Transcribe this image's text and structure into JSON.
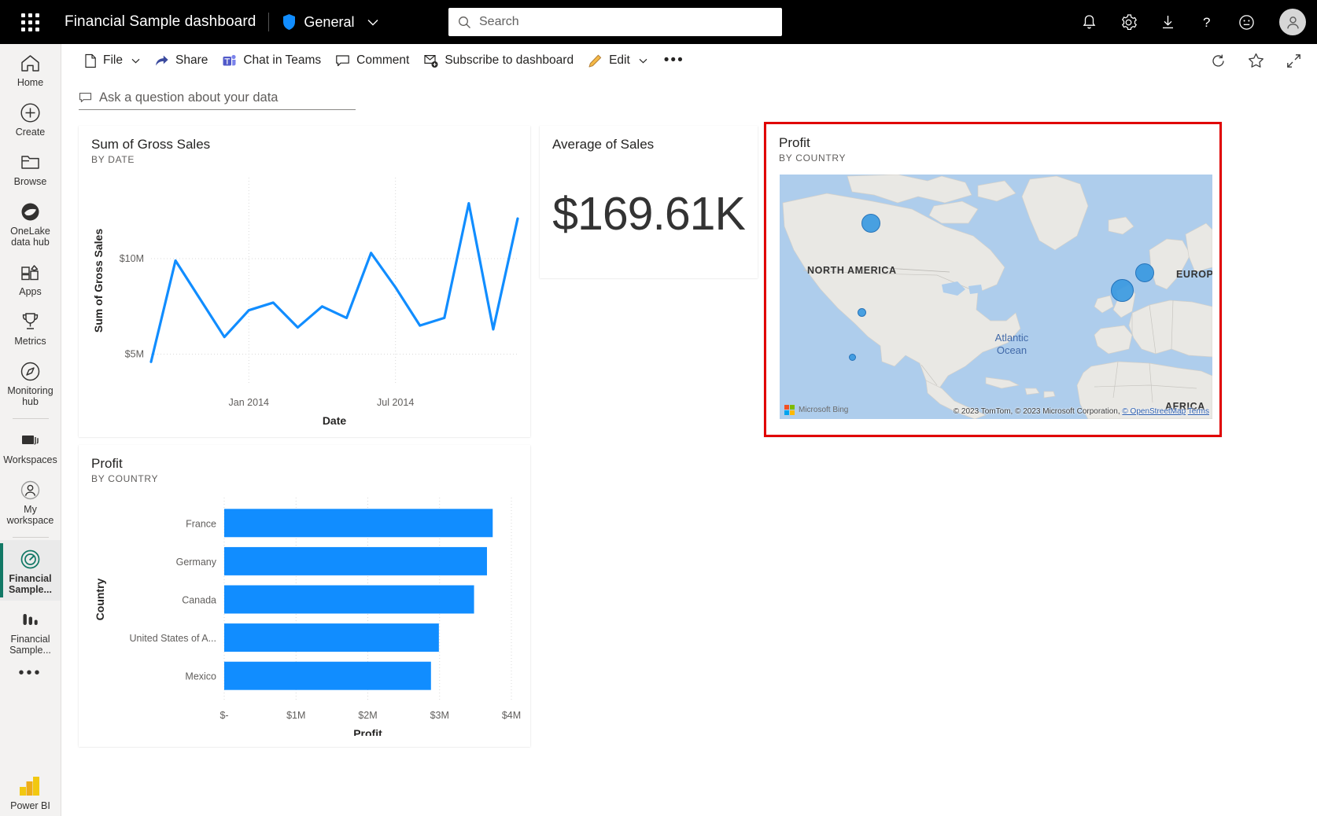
{
  "header": {
    "app_launcher": "waffle-grid",
    "title": "Financial Sample  dashboard",
    "workspace": "General",
    "search_placeholder": "Search",
    "search_value": "",
    "icons": [
      "notifications-bell",
      "settings-gear",
      "download-arrow",
      "help-question",
      "feedback-smiley",
      "account-avatar"
    ]
  },
  "sidebar": {
    "items": [
      {
        "label": "Home",
        "icon": "home-icon",
        "active": false
      },
      {
        "label": "Create",
        "icon": "plus-circle-icon",
        "active": false
      },
      {
        "label": "Browse",
        "icon": "folder-icon",
        "active": false
      },
      {
        "label": "OneLake data hub",
        "icon": "onelake-icon",
        "active": false
      },
      {
        "label": "Apps",
        "icon": "apps-grid-icon",
        "active": false
      },
      {
        "label": "Metrics",
        "icon": "trophy-icon",
        "active": false
      },
      {
        "label": "Monitoring hub",
        "icon": "compass-icon",
        "active": false
      },
      {
        "label": "Workspaces",
        "icon": "workspaces-stack-icon",
        "active": false
      },
      {
        "label": "My workspace",
        "icon": "person-circle-icon",
        "active": false
      },
      {
        "label": "Financial Sample...",
        "icon": "dashboard-gauge-icon",
        "active": true
      },
      {
        "label": "Financial Sample...",
        "icon": "report-bars-icon",
        "active": false
      }
    ],
    "more": "•••",
    "product": "Power BI"
  },
  "toolbar": {
    "file": "File",
    "share": "Share",
    "chat_in_teams": "Chat in Teams",
    "comment": "Comment",
    "subscribe": "Subscribe to dashboard",
    "edit": "Edit",
    "more": "•••",
    "refresh_icon": "refresh-icon",
    "favorite_icon": "star-icon",
    "fullscreen_icon": "fullscreen-icon"
  },
  "qna": {
    "placeholder": "Ask a question about your data",
    "icon": "chat-bubble-icon"
  },
  "tiles": {
    "line": {
      "title": "Sum of Gross Sales",
      "subtitle": "BY DATE"
    },
    "kpi": {
      "title": "Average of Sales",
      "value": "$169.61K"
    },
    "bar": {
      "title": "Profit",
      "subtitle": "BY COUNTRY"
    },
    "map": {
      "title": "Profit",
      "subtitle": "BY COUNTRY",
      "selected": true,
      "selection_color": "#e00000",
      "bing_brand": "Microsoft Bing",
      "attribution": "© 2023 TomTom, © 2023 Microsoft Corporation, ",
      "attribution_link": "© OpenStreetMap",
      "attribution_terms": "Terms",
      "labels": [
        {
          "text": "NORTH AMERICA",
          "kind": "continent"
        },
        {
          "text": "EUROPE",
          "kind": "continent"
        },
        {
          "text": "AFRICA",
          "kind": "continent"
        },
        {
          "text": "Atlantic Ocean",
          "kind": "ocean"
        }
      ],
      "bubbles": [
        {
          "country": "Canada",
          "size": 19
        },
        {
          "country": "France",
          "size": 23
        },
        {
          "country": "Germany",
          "size": 19
        },
        {
          "country": "United States of America",
          "size": 10
        },
        {
          "country": "Mexico",
          "size": 8
        }
      ]
    }
  },
  "chart_data": [
    {
      "type": "line",
      "title": "Sum of Gross Sales",
      "subtitle": "BY DATE",
      "xlabel": "Date",
      "ylabel": "Sum of Gross Sales",
      "ytick_labels": [
        "$5M",
        "$10M"
      ],
      "ytick_values": [
        5000000,
        10000000
      ],
      "ylim": [
        4200000,
        13500000
      ],
      "xtick_labels": [
        "Jan 2014",
        "Jul 2014"
      ],
      "grid": true,
      "series_color": "#118DFF",
      "x": [
        "Sep 2013",
        "Oct 2013",
        "Nov 2013",
        "Dec 2013",
        "Jan 2014",
        "Feb 2014",
        "Mar 2014",
        "Apr 2014",
        "May 2014",
        "Jun 2014",
        "Jul 2014",
        "Aug 2014",
        "Sep 2014",
        "Oct 2014",
        "Nov 2014",
        "Dec 2014"
      ],
      "values": [
        4600000,
        9900000,
        7900000,
        5900000,
        7300000,
        7700000,
        6400000,
        7500000,
        6900000,
        10300000,
        8500000,
        6500000,
        6900000,
        12900000,
        6300000,
        12100000
      ]
    },
    {
      "type": "bar",
      "orientation": "horizontal",
      "title": "Profit",
      "subtitle": "BY COUNTRY",
      "xlabel": "Profit",
      "ylabel": "Country",
      "categories": [
        "France",
        "Germany",
        "Canada",
        "United States of A...",
        "Mexico"
      ],
      "values": [
        3740000,
        3660000,
        3480000,
        2990000,
        2880000
      ],
      "xtick_labels": [
        "$-",
        "$1M",
        "$2M",
        "$3M",
        "$4M"
      ],
      "xtick_values": [
        0,
        1000000,
        2000000,
        3000000,
        4000000
      ],
      "xlim": [
        0,
        4000000
      ],
      "grid": true,
      "series_color": "#118DFF"
    },
    {
      "type": "card",
      "title": "Average of Sales",
      "value": "$169.61K"
    }
  ]
}
